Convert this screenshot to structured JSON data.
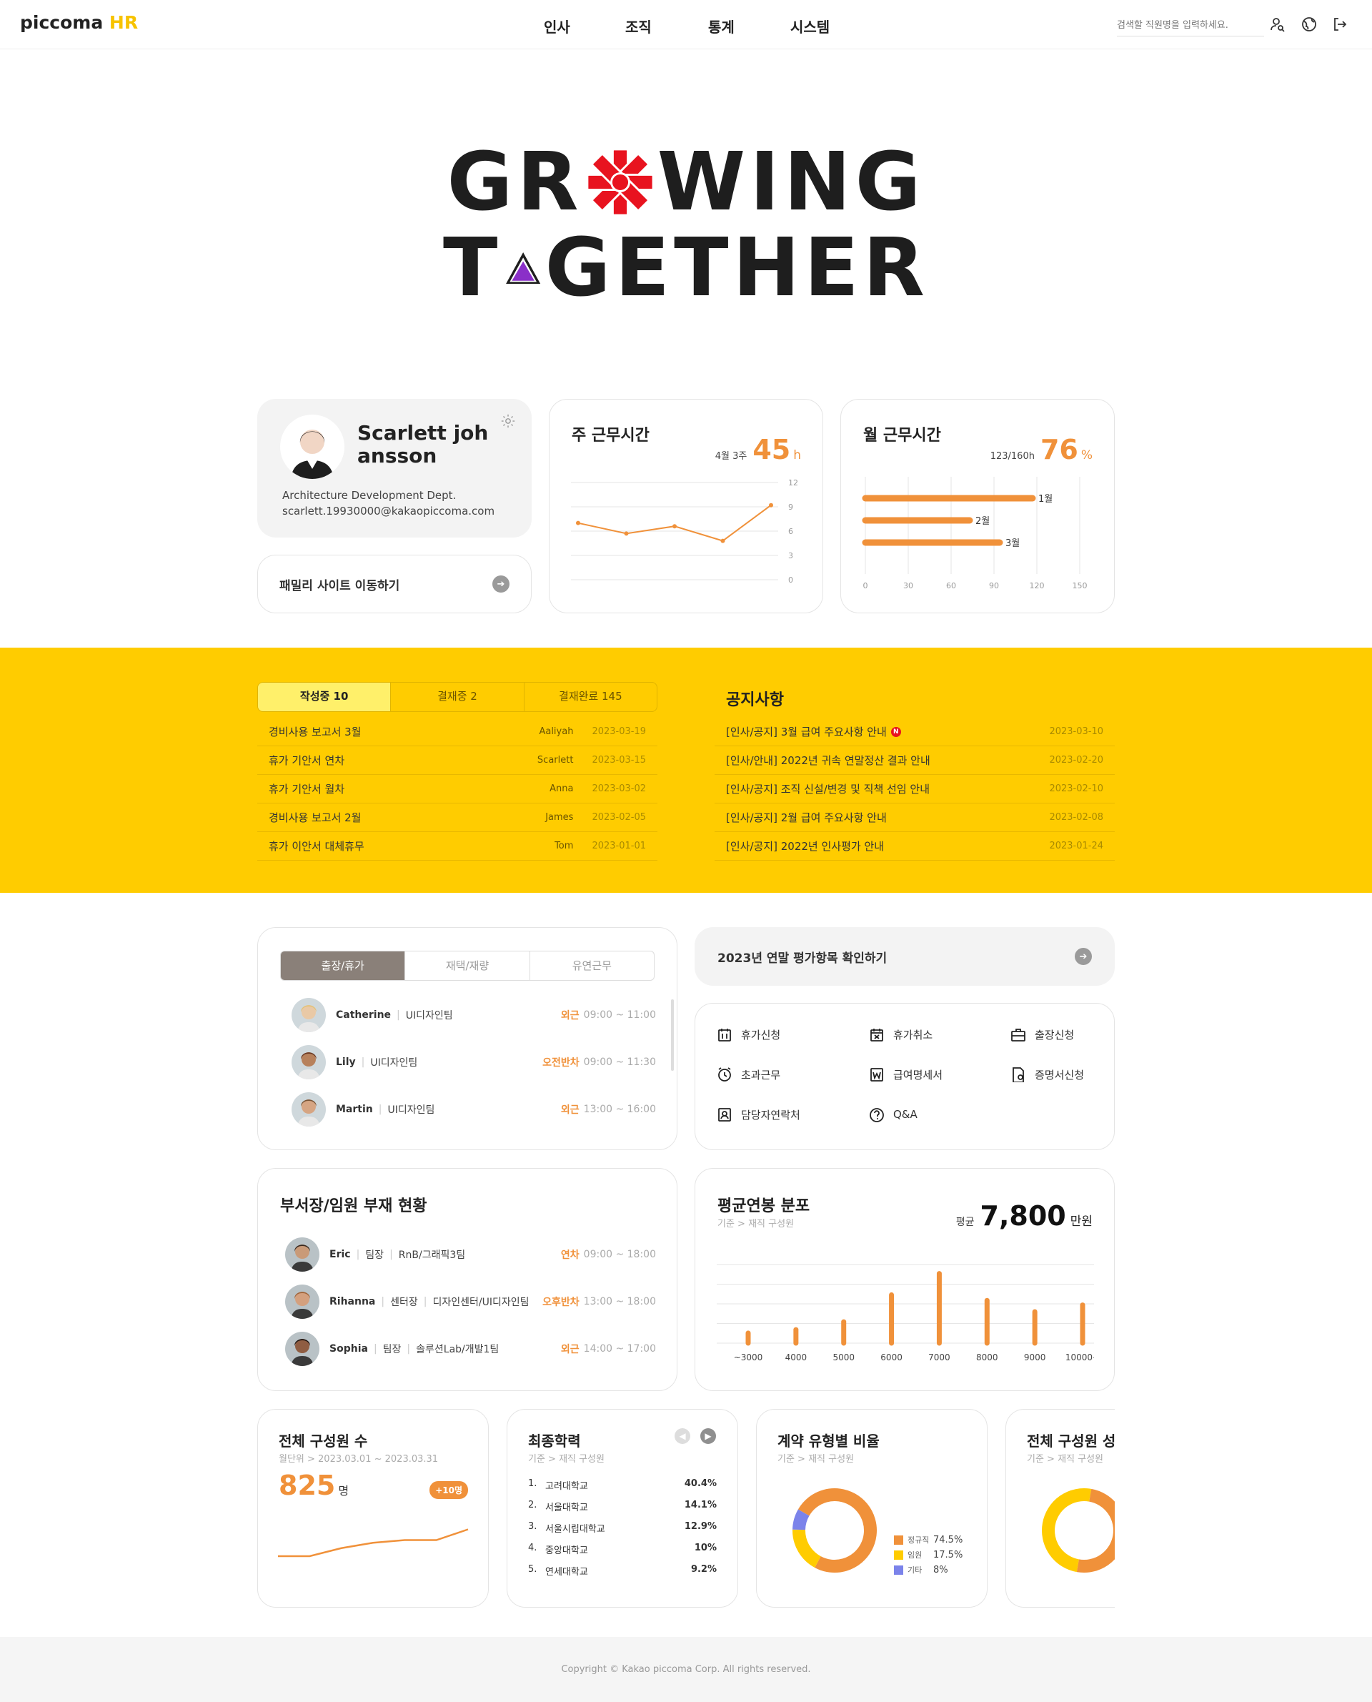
{
  "header": {
    "logo_main": "piccoma",
    "logo_accent": "HR",
    "nav": [
      "인사",
      "조직",
      "통계",
      "시스템"
    ],
    "search_placeholder": "검색할 직원명을 입력하세요.",
    "icons": [
      "user-search-icon",
      "globe-icon",
      "logout-icon"
    ]
  },
  "hero": {
    "line1_a": "GR",
    "line1_b": "WING",
    "line2_a": "T",
    "line2_b": "GETHER"
  },
  "profile": {
    "name": "Scarlett johansson",
    "dept": "Architecture Development Dept.",
    "email": "scarlett.19930000@kakaopiccoma.com",
    "family_site": "패밀리 사이트 이동하기"
  },
  "weekly": {
    "title": "주 근무시간",
    "period": "4월 3주",
    "value": "45",
    "unit": "h"
  },
  "monthly": {
    "title": "월 근무시간",
    "ratio": "123/160h",
    "value": "76",
    "unit": "%"
  },
  "approvals": {
    "tabs": [
      "작성중 10",
      "결재중 2",
      "결재완료 145"
    ],
    "rows": [
      {
        "title": "경비사용 보고서 3월",
        "author": "Aaliyah",
        "date": "2023-03-19"
      },
      {
        "title": "휴가 기안서 연차",
        "author": "Scarlett",
        "date": "2023-03-15"
      },
      {
        "title": "휴가 기안서 월차",
        "author": "Anna",
        "date": "2023-03-02"
      },
      {
        "title": "경비사용 보고서 2월",
        "author": "James",
        "date": "2023-02-05"
      },
      {
        "title": "휴가 이안서 대체휴무",
        "author": "Tom",
        "date": "2023-01-01"
      }
    ]
  },
  "notice": {
    "title": "공지사항",
    "new_badge": "N",
    "rows": [
      {
        "title": "[인사/공지] 3월 급여 주요사항 안내",
        "date": "2023-03-10"
      },
      {
        "title": "[인사/안내] 2022년 귀속 연말정산 결과 안내",
        "date": "2023-02-20"
      },
      {
        "title": "[인사/공지] 조직 신설/변경 및 직책 선임 안내",
        "date": "2023-02-10"
      },
      {
        "title": "[인사/공지] 2월 급여 주요사항 안내",
        "date": "2023-02-08"
      },
      {
        "title": "[인사/공지] 2022년 인사평가 안내",
        "date": "2023-01-24"
      }
    ]
  },
  "leave": {
    "tabs": [
      "출장/휴가",
      "재택/재량",
      "유연근무"
    ],
    "people": [
      {
        "name": "Catherine",
        "team": "UI디자인팀",
        "status": "외근",
        "time": "09:00 ~ 11:00"
      },
      {
        "name": "Lily",
        "team": "UI디자인팀",
        "status": "오전반차",
        "time": "09:00 ~ 11:30"
      },
      {
        "name": "Martin",
        "team": "UI디자인팀",
        "status": "외근",
        "time": "13:00 ~ 16:00"
      }
    ]
  },
  "evaluation": {
    "label": "2023년 연말 평가항목 확인하기"
  },
  "quick_menu": [
    {
      "label": "휴가신청",
      "icon": "calendar-icon"
    },
    {
      "label": "휴가취소",
      "icon": "calendar-cancel-icon"
    },
    {
      "label": "출장신청",
      "icon": "briefcase-icon"
    },
    {
      "label": "초과근무",
      "icon": "alarm-clock-icon"
    },
    {
      "label": "급여명세서",
      "icon": "payslip-icon"
    },
    {
      "label": "증명서신청",
      "icon": "certificate-icon"
    },
    {
      "label": "담당자연락처",
      "icon": "contact-icon"
    },
    {
      "label": "Q&A",
      "icon": "question-icon"
    }
  ],
  "absence": {
    "title": "부서장/임원 부재 현황",
    "people": [
      {
        "name": "Eric",
        "role": "팀장",
        "team": "RnB/그래픽3팀",
        "status": "연차",
        "time": "09:00 ~ 18:00"
      },
      {
        "name": "Rihanna",
        "role": "센터장",
        "team": "디자인센터/UI디자인팀",
        "status": "오후반차",
        "time": "13:00 ~ 18:00"
      },
      {
        "name": "Sophia",
        "role": "팀장",
        "team": "솔루션Lab/개발1팀",
        "status": "외근",
        "time": "14:00 ~ 17:00"
      }
    ]
  },
  "salary": {
    "title": "평균연봉 분포",
    "subtitle": "기준 > 재직 구성원",
    "avg_label": "평균",
    "avg_value": "7,800",
    "avg_unit": "만원"
  },
  "headcount": {
    "title": "전체 구성원 수",
    "subtitle": "월단위 > 2023.03.01 ~ 2023.03.31",
    "value": "825",
    "unit": "명",
    "badge": "+10명"
  },
  "education": {
    "title": "최종학력",
    "subtitle": "기준 > 재직 구성원",
    "rows": [
      {
        "rank": "1.",
        "name": "고려대학교",
        "pct": "40.4%"
      },
      {
        "rank": "2.",
        "name": "서울대학교",
        "pct": "14.1%"
      },
      {
        "rank": "3.",
        "name": "서울시립대학교",
        "pct": "12.9%"
      },
      {
        "rank": "4.",
        "name": "중앙대학교",
        "pct": "10%"
      },
      {
        "rank": "5.",
        "name": "연세대학교",
        "pct": "9.2%"
      }
    ]
  },
  "contract": {
    "title": "계약 유형별 비율",
    "subtitle": "기준 > 재직 구성원",
    "legend": [
      {
        "label": "정규직",
        "pct": "74.5%",
        "color": "#f0913a"
      },
      {
        "label": "임원",
        "pct": "17.5%",
        "color": "#ffcc00"
      },
      {
        "label": "기타",
        "pct": "8%",
        "color": "#7b83ea"
      }
    ]
  },
  "gender": {
    "title": "전체 구성원 성비",
    "subtitle": "기준 > 재직 구성원"
  },
  "footer": {
    "copyright": "Copyright © Kakao piccoma Corp. All rights reserved."
  },
  "chart_data": [
    {
      "type": "line",
      "x": [
        "1",
        "2",
        "3",
        "4",
        "5"
      ],
      "values": [
        7,
        5.7,
        6.6,
        4.8,
        9.2
      ],
      "ylim": [
        0,
        12
      ],
      "yticks": [
        "0",
        "3",
        "6",
        "9",
        "12"
      ],
      "color": "#f0913a"
    },
    {
      "type": "bar",
      "orientation": "horizontal",
      "categories": [
        "1월",
        "2월",
        "3월"
      ],
      "values": [
        117,
        73,
        94
      ],
      "xlim": [
        0,
        150
      ],
      "xticks": [
        "0",
        "30",
        "60",
        "90",
        "120",
        "150"
      ],
      "color": "#f0913a"
    },
    {
      "type": "bar",
      "categories": [
        "~3000",
        "4000",
        "5000",
        "6000",
        "7000",
        "8000",
        "9000",
        "10000~"
      ],
      "values": [
        9,
        12,
        19,
        43,
        62,
        38,
        28,
        34
      ],
      "ylim": [
        0,
        70
      ],
      "color": "#f0913a"
    },
    {
      "type": "line",
      "values": [
        815,
        815,
        818,
        820,
        821,
        821,
        825
      ],
      "color": "#f0913a"
    },
    {
      "type": "pie",
      "categories": [
        "정규직",
        "임원",
        "기타"
      ],
      "values": [
        74.5,
        17.5,
        8
      ],
      "colors": [
        "#f0913a",
        "#ffcc00",
        "#7b83ea"
      ]
    },
    {
      "type": "pie",
      "values": [
        50,
        50
      ],
      "colors": [
        "#f0913a",
        "#ffcc00"
      ]
    }
  ]
}
